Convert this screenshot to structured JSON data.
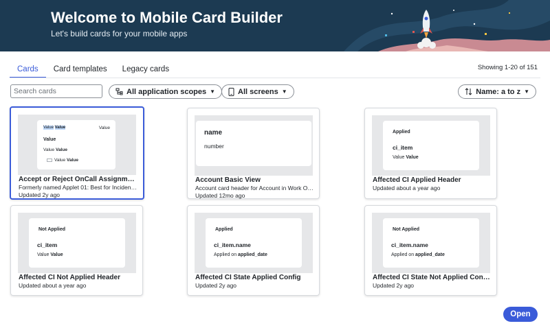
{
  "banner": {
    "title": "Welcome to Mobile Card Builder",
    "subtitle": "Let's build cards for your mobile apps"
  },
  "tabs": [
    {
      "label": "Cards",
      "active": true
    },
    {
      "label": "Card templates",
      "active": false
    },
    {
      "label": "Legacy cards",
      "active": false
    }
  ],
  "results_count": "Showing 1-20 of 151",
  "toolbar": {
    "search_placeholder": "Search cards",
    "scope_filter": "All application scopes",
    "screen_filter": "All screens",
    "sort": "Name: a to z"
  },
  "cards": [
    {
      "title": "Accept or Reject OnCall Assignment…",
      "description": "Formerly named Applet 01: Best for Incidents,…",
      "updated": "Updated 2y ago",
      "preview": {
        "top_left_a": "Value",
        "top_left_b": "Value",
        "top_right": "Value",
        "heading": "Value",
        "line2_a": "Value",
        "line2_b": "Value",
        "line3_a": "Value",
        "line3_b": "Value"
      }
    },
    {
      "title": "Account Basic View",
      "description": "Account card header for Account in Work Order",
      "updated": "Updated 12mo ago",
      "preview": {
        "heading": "name",
        "sub": "number"
      }
    },
    {
      "title": "Affected CI Applied Header",
      "updated": "Updated about a year ago",
      "preview": {
        "badge": "Applied",
        "heading": "ci_item",
        "line_a": "Value",
        "line_b": "Value"
      }
    },
    {
      "title": "Affected CI Not Applied Header",
      "updated": "Updated about a year ago",
      "preview": {
        "badge": "Not Applied",
        "heading": "ci_item",
        "line_a": "Value",
        "line_b": "Value"
      }
    },
    {
      "title": "Affected CI State Applied Config",
      "updated": "Updated 2y ago",
      "preview": {
        "badge": "Applied",
        "heading": "ci_item.name",
        "line_a": "Applied on",
        "line_b": "applied_date"
      }
    },
    {
      "title": "Affected CI State Not Applied Config",
      "updated": "Updated 2y ago",
      "preview": {
        "badge": "Not Applied",
        "heading": "ci_item.name",
        "line_a": "Applied on",
        "line_b": "applied_date"
      }
    }
  ],
  "open_button": "Open",
  "colors": {
    "accent": "#3a5bd9",
    "banner": "#1c3a52"
  }
}
